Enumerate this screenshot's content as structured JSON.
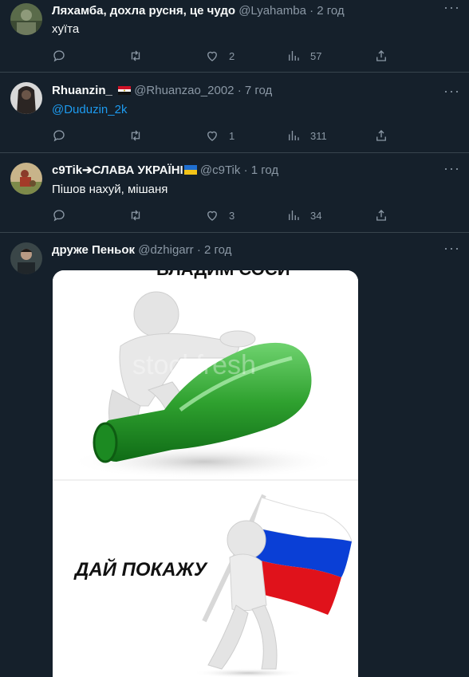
{
  "tweets": [
    {
      "name": "Ляхамба, дохла русня, це чудо",
      "handle": "@Lyahamba",
      "time": "· 2 год",
      "text": "хуїта",
      "replies": "",
      "retweets": "",
      "likes": "2",
      "views": "57"
    },
    {
      "name": "Rhuanzin_",
      "handle": "@Rhuanzao_2002",
      "time": "· 7 год",
      "text": "@Duduzin_2k",
      "replies": "",
      "retweets": "",
      "likes": "1",
      "views": "311"
    },
    {
      "name": "c9Tik➔СЛАВА УКРАЇНІ",
      "handle": "@c9Tik",
      "time": "· 1 год",
      "text": "Пішов нахуй, мішаня",
      "replies": "",
      "retweets": "",
      "likes": "3",
      "views": "34"
    },
    {
      "name": "друже Пеньок",
      "handle": "@dzhigarr",
      "time": "· 2 год"
    }
  ],
  "meme": {
    "top_caption": "ВЛАДИМ СОСИ",
    "watermark": "stockfresh",
    "bottom_caption": "ДАЙ ПОКАЖУ"
  },
  "colors": {
    "background": "#15202b",
    "link": "#1d9bf0",
    "muted": "#8b98a5",
    "bottle_green": "#2fa12f"
  },
  "icons": [
    "reply-icon",
    "retweet-icon",
    "like-icon",
    "views-icon",
    "share-icon",
    "more-icon"
  ]
}
